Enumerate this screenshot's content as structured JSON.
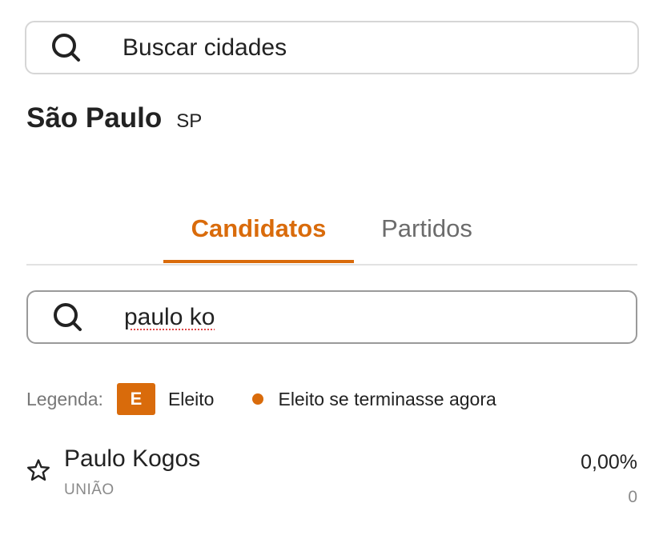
{
  "city_search": {
    "placeholder": "Buscar cidades",
    "icon": "search-icon"
  },
  "city": {
    "name": "São Paulo",
    "state": "SP"
  },
  "tabs": [
    {
      "label": "Candidatos",
      "active": true
    },
    {
      "label": "Partidos",
      "active": false
    }
  ],
  "candidate_search": {
    "value": "paulo ko",
    "icon": "search-icon"
  },
  "legend": {
    "label": "Legenda:",
    "elected_badge": "E",
    "elected_text": "Eleito",
    "elected_if_now_text": "Eleito se terminasse agora"
  },
  "candidates": [
    {
      "name": "Paulo Kogos",
      "party": "UNIÃO",
      "percent": "0,00%",
      "votes": "0",
      "favorite_icon": "star-outline-icon"
    }
  ],
  "colors": {
    "accent": "#d96b0b",
    "text": "#222222",
    "muted": "#8a8a8a",
    "border": "#d6d6d6"
  }
}
